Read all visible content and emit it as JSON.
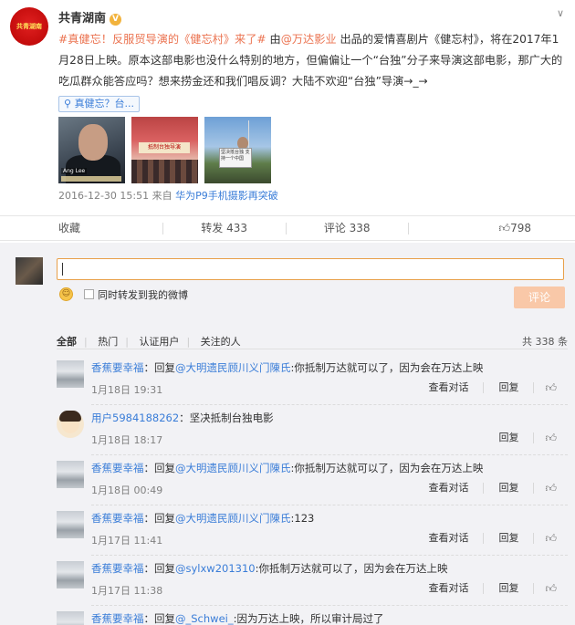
{
  "post": {
    "author": "共青湖南",
    "verified_badge": "V",
    "avatar_text": "共青湖南",
    "more_icon": "chevron-down-icon",
    "content": {
      "topic": "#真健忘！反服贸导演的《健忘村》来了#",
      "mid1": " 由",
      "mention": "@万达影业",
      "mid2": " 出品的爱情喜剧片《健忘村》，将在2017年1月28日上映。原本这部电影也没什么特别的地方，但偏偏让一个“台独”分子来导演这部电影，那广大的吃瓜群众能答应吗？想来捞金还和我们唱反调？大陆不欢迎“台独”导演→_→"
    },
    "topic_chip": "真健忘？台...",
    "image_captions": {
      "thumb1_name": "Ang Lee",
      "thumb2_banner": "抵制台独导演",
      "thumb3_sign": "坚决抵台独 支持一个中国"
    },
    "time": "2016-12-30 15:51",
    "from_label": "来自",
    "device": "华为P9手机摄影再突破"
  },
  "actions": {
    "favorite": "收藏",
    "repost": "转发 433",
    "comment": "评论 338",
    "like": "798",
    "like_icon": "thumbs-up-icon"
  },
  "composer": {
    "input_value": "",
    "emoji_icon": "smiley-icon",
    "repost_checkbox_label": "同时转发到我的微博",
    "submit_label": "评论"
  },
  "filters": {
    "tabs": [
      "全部",
      "热门",
      "认证用户",
      "关注的人"
    ],
    "count": "共 338 条"
  },
  "comments": [
    {
      "user": "香蕉要幸福",
      "reply_prefix": "：回复",
      "mention": "@大明遗民顾川义门陳氏",
      "text": ":你抵制万达就可以了，因为会在万达上映",
      "time": "1月18日 19:31",
      "ops": [
        "查看对话",
        "回复"
      ]
    },
    {
      "user": "用户5984188262",
      "reply_prefix": "",
      "mention": "",
      "text": "：坚决抵制台独电影",
      "time": "1月18日 18:17",
      "ops": [
        "回复"
      ]
    },
    {
      "user": "香蕉要幸福",
      "reply_prefix": "：回复",
      "mention": "@大明遗民顾川义门陳氏",
      "text": ":你抵制万达就可以了，因为会在万达上映",
      "time": "1月18日 00:49",
      "ops": [
        "查看对话",
        "回复"
      ]
    },
    {
      "user": "香蕉要幸福",
      "reply_prefix": "：回复",
      "mention": "@大明遗民顾川义门陳氏",
      "text": ":123",
      "time": "1月17日 11:41",
      "ops": [
        "查看对话",
        "回复"
      ]
    },
    {
      "user": "香蕉要幸福",
      "reply_prefix": "：回复",
      "mention": "@sylxw201310",
      "text": ":你抵制万达就可以了，因为会在万达上映",
      "time": "1月17日 11:38",
      "ops": [
        "查看对话",
        "回复"
      ]
    },
    {
      "user": "香蕉要幸福",
      "reply_prefix": "：回复",
      "mention": "@_Schwei_",
      "text": ":因为万达上映，所以审计局过了",
      "time": "",
      "ops": []
    }
  ]
}
